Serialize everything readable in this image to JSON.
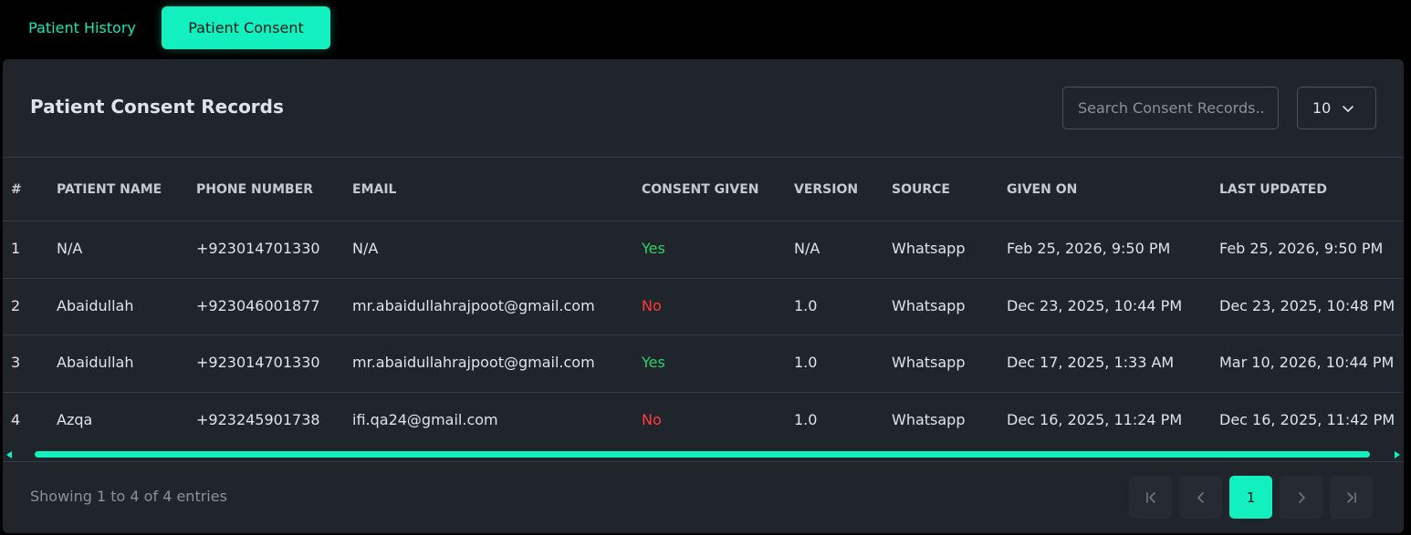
{
  "tabs": {
    "history": "Patient History",
    "consent": "Patient Consent"
  },
  "card": {
    "title": "Patient Consent Records",
    "search_placeholder": "Search Consent Records...",
    "page_size": "10"
  },
  "table": {
    "headers": [
      "#",
      "PATIENT NAME",
      "PHONE NUMBER",
      "EMAIL",
      "CONSENT GIVEN",
      "VERSION",
      "SOURCE",
      "GIVEN ON",
      "LAST UPDATED"
    ],
    "rows": [
      [
        "1",
        "N/A",
        "+923014701330",
        "N/A",
        "Yes",
        "N/A",
        "Whatsapp",
        "Feb 25, 2026, 9:50 PM",
        "Feb 25, 2026, 9:50 PM"
      ],
      [
        "2",
        "Abaidullah",
        "+923046001877",
        "mr.abaidullahrajpoot@gmail.com",
        "No",
        "1.0",
        "Whatsapp",
        "Dec 23, 2025, 10:44 PM",
        "Dec 23, 2025, 10:48 PM"
      ],
      [
        "3",
        "Abaidullah",
        "+923014701330",
        "mr.abaidullahrajpoot@gmail.com",
        "Yes",
        "1.0",
        "Whatsapp",
        "Dec 17, 2025, 1:33 AM",
        "Mar 10, 2026, 10:44 PM"
      ],
      [
        "4",
        "Azqa",
        "+923245901738",
        "ifi.qa24@gmail.com",
        "No",
        "1.0",
        "Whatsapp",
        "Dec 16, 2025, 11:24 PM",
        "Dec 16, 2025, 11:42 PM"
      ]
    ]
  },
  "footer": {
    "showing": "Showing 1 to 4 of 4 entries",
    "current_page": "1"
  },
  "icons": {
    "first": "first-page-icon",
    "prev": "prev-page-icon",
    "next": "next-page-icon",
    "last": "last-page-icon",
    "dropdown": "chevron-down-icon"
  },
  "colors": {
    "accent": "#12f0bf",
    "yes": "#2ed16a",
    "no": "#ff3b3b",
    "card_bg": "#20252c",
    "page_bg": "#000000"
  }
}
